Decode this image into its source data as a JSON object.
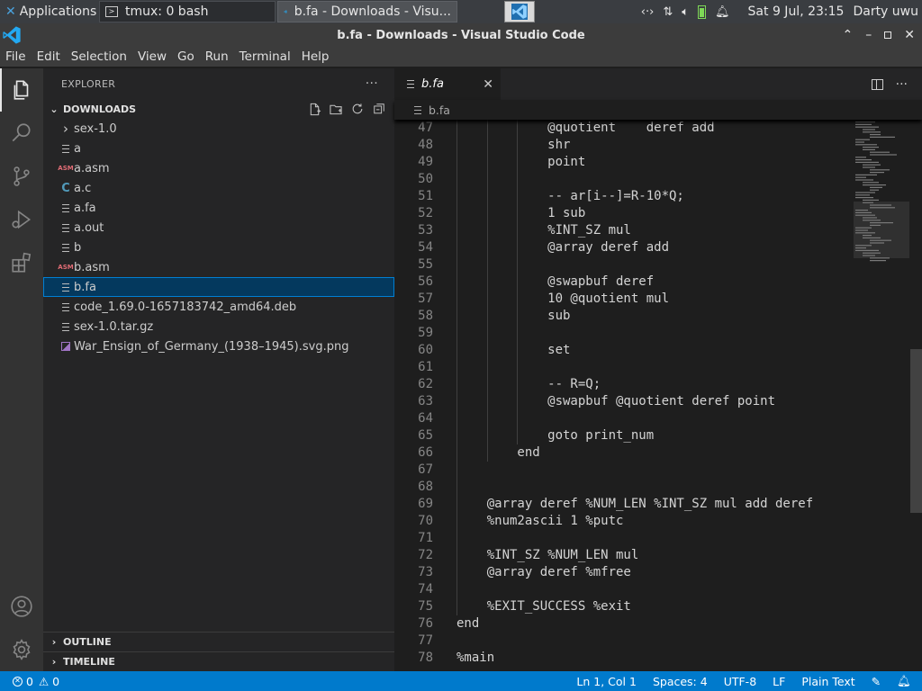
{
  "taskbar": {
    "apps_label": "Applications",
    "tmux_label": "tmux: 0 bash",
    "vscode_label": "b.fa - Downloads - Visu...",
    "clock": "Sat  9 Jul, 23:15",
    "user": "Darty uwu",
    "icons": [
      "network-icon",
      "transfer-icon",
      "volume-icon",
      "battery-icon",
      "bell-icon"
    ]
  },
  "window": {
    "title": "b.fa - Downloads - Visual Studio Code",
    "controls": [
      "minimize",
      "maximize",
      "close"
    ]
  },
  "menu": [
    "File",
    "Edit",
    "Selection",
    "View",
    "Go",
    "Run",
    "Terminal",
    "Help"
  ],
  "activity_bar": [
    "explorer",
    "search",
    "source-control",
    "run-debug",
    "extensions",
    "accounts",
    "manage"
  ],
  "sidebar": {
    "header": "EXPLORER",
    "more": "···",
    "section": "DOWNLOADS",
    "items": [
      {
        "label": "sex-1.0",
        "kind": "folder"
      },
      {
        "label": "a",
        "kind": "text"
      },
      {
        "label": "a.asm",
        "kind": "asm",
        "icon_text": "ASM"
      },
      {
        "label": "a.c",
        "kind": "c",
        "icon_text": "C"
      },
      {
        "label": "a.fa",
        "kind": "text"
      },
      {
        "label": "a.out",
        "kind": "text"
      },
      {
        "label": "b",
        "kind": "text"
      },
      {
        "label": "b.asm",
        "kind": "asm",
        "icon_text": "ASM"
      },
      {
        "label": "b.fa",
        "kind": "text",
        "selected": true
      },
      {
        "label": "code_1.69.0-1657183742_amd64.deb",
        "kind": "text"
      },
      {
        "label": "sex-1.0.tar.gz",
        "kind": "text"
      },
      {
        "label": "War_Ensign_of_Germany_(1938–1945).svg.png",
        "kind": "image"
      }
    ],
    "outline": "OUTLINE",
    "timeline": "TIMELINE"
  },
  "editor": {
    "tab_label": "b.fa",
    "breadcrumb": "b.fa",
    "lines": [
      {
        "n": "47",
        "text": "            @quotient    deref add",
        "indent": 3
      },
      {
        "n": "48",
        "text": "            shr",
        "indent": 3
      },
      {
        "n": "49",
        "text": "            point",
        "indent": 3
      },
      {
        "n": "50",
        "text": "",
        "indent": 3
      },
      {
        "n": "51",
        "text": "            -- ar[i--]=R-10*Q;",
        "indent": 3
      },
      {
        "n": "52",
        "text": "            1 sub",
        "indent": 3
      },
      {
        "n": "53",
        "text": "            %INT_SZ mul",
        "indent": 3
      },
      {
        "n": "54",
        "text": "            @array deref add",
        "indent": 3
      },
      {
        "n": "55",
        "text": "",
        "indent": 3
      },
      {
        "n": "56",
        "text": "            @swapbuf deref",
        "indent": 3
      },
      {
        "n": "57",
        "text": "            10 @quotient mul",
        "indent": 3
      },
      {
        "n": "58",
        "text": "            sub",
        "indent": 3
      },
      {
        "n": "59",
        "text": "",
        "indent": 3
      },
      {
        "n": "60",
        "text": "            set",
        "indent": 3
      },
      {
        "n": "61",
        "text": "",
        "indent": 3
      },
      {
        "n": "62",
        "text": "            -- R=Q;",
        "indent": 3
      },
      {
        "n": "63",
        "text": "            @swapbuf @quotient deref point",
        "indent": 3
      },
      {
        "n": "64",
        "text": "",
        "indent": 3
      },
      {
        "n": "65",
        "text": "            goto print_num",
        "indent": 3
      },
      {
        "n": "66",
        "text": "        end",
        "indent": 2
      },
      {
        "n": "67",
        "text": "",
        "indent": 1
      },
      {
        "n": "68",
        "text": "",
        "indent": 1
      },
      {
        "n": "69",
        "text": "    @array deref %NUM_LEN %INT_SZ mul add deref",
        "indent": 1
      },
      {
        "n": "70",
        "text": "    %num2ascii 1 %putc",
        "indent": 1
      },
      {
        "n": "71",
        "text": "",
        "indent": 1
      },
      {
        "n": "72",
        "text": "    %INT_SZ %NUM_LEN mul",
        "indent": 1
      },
      {
        "n": "73",
        "text": "    @array deref %mfree",
        "indent": 1
      },
      {
        "n": "74",
        "text": "",
        "indent": 1
      },
      {
        "n": "75",
        "text": "    %EXIT_SUCCESS %exit",
        "indent": 1
      },
      {
        "n": "76",
        "text": "end",
        "indent": 0
      },
      {
        "n": "77",
        "text": "",
        "indent": 0
      },
      {
        "n": "78",
        "text": "%main",
        "indent": 0
      }
    ]
  },
  "status": {
    "errors": "0",
    "warnings": "0",
    "position": "Ln 1, Col 1",
    "spaces": "Spaces: 4",
    "encoding": "UTF-8",
    "eol": "LF",
    "language": "Plain Text"
  },
  "colors": {
    "accent": "#007acc",
    "selection": "#04395e",
    "asm_icon": "#e06c75",
    "c_icon": "#519aba",
    "vscode_blue": "#23a9f2"
  }
}
